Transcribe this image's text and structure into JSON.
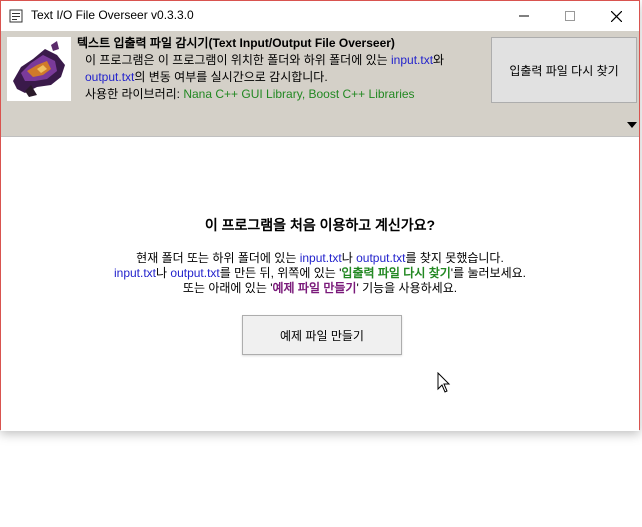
{
  "window": {
    "title": "Text I/O File Overseer v0.3.3.0",
    "border_color": "#d9534f"
  },
  "header": {
    "title": "텍스트 입출력 파일 감시기(Text Input/Output File Overseer)",
    "line1": {
      "pre": "이 프로그램은 이 프로그램이 위치한 폴더와 하위 폴더에 있는 ",
      "file": "input.txt",
      "post": "와"
    },
    "line2": {
      "file": "output.txt",
      "post": "의 변동 여부를 실시간으로 감시합니다."
    },
    "line3": {
      "pre": "사용한 라이브러리: ",
      "libs": "Nana C++ GUI Library, Boost C++ Libraries"
    },
    "rediscover_button": "입출력 파일 다시 찾기",
    "colors": {
      "file": "#2222cc",
      "libs": "#228822"
    }
  },
  "main": {
    "question": "이 프로그램을 처음 이용하고 계신가요?",
    "desc1": {
      "pre": "현재 폴더 또는 하위 폴더에 있는 ",
      "file1": "input.txt",
      "mid": "나 ",
      "file2": "output.txt",
      "post": "를 찾지 못했습니다."
    },
    "desc2": {
      "file1": "input.txt",
      "mid1": "나 ",
      "file2": "output.txt",
      "mid2": "를 만든 뒤, 위쪽에 있는 '",
      "button_ref": "입출력 파일 다시 찾기",
      "post": "'를 눌러보세요."
    },
    "desc3": {
      "pre": "또는 아래에 있는 '",
      "button_ref": "예제 파일 만들기",
      "post": "' 기능을 사용하세요."
    },
    "example_button": "예제 파일 만들기",
    "colors": {
      "file": "#2222cc",
      "ref1": "#228822",
      "ref2": "#7a1a7a"
    }
  },
  "icons": [
    "app-icon",
    "minimize-icon",
    "maximize-icon",
    "close-icon",
    "logo-image",
    "collapse-arrow-icon",
    "mouse-cursor-icon"
  ]
}
